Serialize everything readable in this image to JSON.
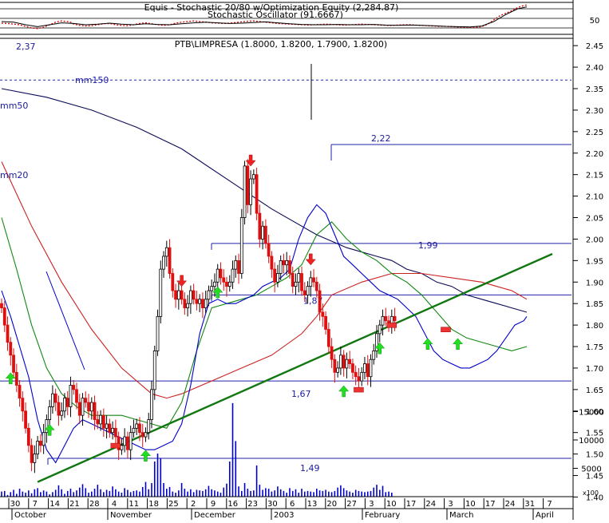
{
  "chart_data": [
    {
      "type": "line",
      "title": "Equis - Stochastic 20/80 w/Optimization Equity (2,284.87)",
      "subtitle": "Stochastic Oscillator (91.6667)",
      "y_ticks": [
        "50"
      ],
      "levels": [
        20,
        50,
        80
      ],
      "series": [
        {
          "color": "#cc0000",
          "style": "dotted",
          "x": [
            0,
            2,
            4,
            6,
            8,
            10,
            12,
            14,
            16,
            18,
            20,
            22,
            23,
            24,
            26,
            28,
            30,
            32,
            34,
            36,
            38,
            40,
            42,
            44,
            46,
            48,
            50,
            52,
            54,
            56,
            58,
            60,
            62,
            64,
            66,
            68,
            70,
            72,
            74,
            76,
            78,
            80,
            82,
            84,
            86,
            88,
            90,
            92,
            94,
            96,
            98,
            100,
            102,
            104,
            106,
            108,
            110,
            112,
            114,
            116,
            118,
            120,
            122,
            124,
            126,
            128,
            130,
            132,
            134,
            136,
            138,
            140,
            142,
            144,
            146,
            148,
            150,
            152,
            154,
            156,
            158,
            160,
            162,
            164,
            166,
            168,
            170,
            172,
            174,
            175
          ],
          "y": [
            35,
            34,
            32,
            30,
            25,
            20,
            18,
            22,
            30,
            38,
            42,
            40,
            38,
            32,
            28,
            26,
            27,
            30,
            33,
            34,
            30,
            28,
            27,
            30,
            34,
            36,
            33,
            30,
            28,
            30,
            35,
            38,
            40,
            42,
            40,
            38,
            36,
            35,
            34,
            35,
            37,
            39,
            41,
            42,
            40,
            38,
            36,
            34,
            33,
            32,
            31,
            30,
            29,
            30,
            31,
            32,
            31,
            30,
            29,
            30,
            31,
            32,
            31,
            30,
            29,
            28,
            28,
            29,
            30,
            30,
            29,
            28,
            27,
            26,
            25,
            25,
            24,
            23,
            23,
            22,
            22,
            24,
            32,
            45,
            58,
            66,
            74,
            84,
            90,
            92
          ]
        },
        {
          "color": "#000000",
          "style": "solid",
          "x": [
            0,
            4,
            8,
            12,
            16,
            20,
            24,
            28,
            32,
            36,
            40,
            44,
            48,
            52,
            56,
            60,
            64,
            68,
            72,
            76,
            80,
            84,
            88,
            92,
            96,
            100,
            104,
            108,
            112,
            116,
            120,
            124,
            128,
            132,
            136,
            140,
            144,
            148,
            152,
            156,
            160,
            164,
            168,
            172,
            175
          ],
          "y": [
            40,
            38,
            30,
            24,
            30,
            36,
            34,
            30,
            32,
            35,
            32,
            30,
            33,
            31,
            30,
            33,
            36,
            38,
            36,
            34,
            35,
            37,
            39,
            36,
            33,
            31,
            30,
            30,
            31,
            30,
            30,
            31,
            29,
            28,
            29,
            28,
            27,
            25,
            24,
            23,
            26,
            40,
            62,
            80,
            86
          ]
        }
      ]
    },
    {
      "type": "candlestick",
      "title": "PTB\\LIMPRESA (1.8000, 1.8200, 1.7900, 1.8200)",
      "y_ticks": [
        "2.45",
        "2.40",
        "2.35",
        "2.30",
        "2.25",
        "2.20",
        "2.15",
        "2.10",
        "2.05",
        "2.00",
        "1.95",
        "1.90",
        "1.85",
        "1.80",
        "1.75",
        "1.70",
        "1.65",
        "1.60",
        "1.55",
        "1.50",
        "1.45",
        "1.40"
      ],
      "ylim": [
        1.373,
        2.467
      ],
      "x_dates": [
        "30",
        "7",
        "14",
        "21",
        "28",
        "4",
        "11",
        "18",
        "25",
        "2",
        "9",
        "16",
        "23",
        "30",
        "6",
        "13",
        "20",
        "27",
        "3",
        "10",
        "17",
        "24",
        "3",
        "10",
        "17",
        "24",
        "31",
        "7"
      ],
      "x_months": [
        "October",
        "November",
        "December",
        "2003",
        "February",
        "March",
        "April"
      ],
      "support_levels": [
        {
          "label": "2,37",
          "value": 2.37
        },
        {
          "label": "2,22",
          "value": 2.22
        },
        {
          "label": "1,99",
          "value": 1.99
        },
        {
          "label": "1,87",
          "value": 1.87
        },
        {
          "label": "1,67",
          "value": 1.67
        },
        {
          "label": "1,49",
          "value": 1.49
        }
      ],
      "moving_averages": [
        {
          "name": "mm150",
          "color": "#0a0a55",
          "x": [
            0,
            15,
            30,
            45,
            60,
            75,
            90,
            105,
            115,
            125,
            130,
            135,
            140,
            145,
            150,
            155,
            160,
            165,
            170,
            175
          ],
          "y": [
            2.35,
            2.33,
            2.3,
            2.26,
            2.21,
            2.14,
            2.07,
            2.01,
            1.98,
            1.96,
            1.95,
            1.93,
            1.92,
            1.9,
            1.89,
            1.87,
            1.86,
            1.85,
            1.84,
            1.83
          ]
        },
        {
          "name": "mm50",
          "color": "#cc2222",
          "x": [
            0,
            10,
            20,
            30,
            40,
            50,
            55,
            60,
            70,
            80,
            90,
            100,
            105,
            110,
            120,
            130,
            140,
            150,
            160,
            165,
            170,
            175
          ],
          "y": [
            2.18,
            2.03,
            1.9,
            1.79,
            1.7,
            1.64,
            1.63,
            1.64,
            1.67,
            1.7,
            1.73,
            1.78,
            1.82,
            1.87,
            1.9,
            1.92,
            1.92,
            1.91,
            1.9,
            1.89,
            1.88,
            1.86
          ]
        },
        {
          "name": "mm20",
          "color": "#118811",
          "x": [
            0,
            5,
            10,
            15,
            20,
            25,
            30,
            35,
            40,
            45,
            50,
            55,
            60,
            65,
            70,
            75,
            80,
            85,
            90,
            95,
            100,
            105,
            110,
            115,
            120,
            125,
            130,
            135,
            140,
            145,
            150,
            155,
            160,
            165,
            170,
            175
          ],
          "y": [
            2.05,
            1.93,
            1.8,
            1.7,
            1.64,
            1.61,
            1.59,
            1.59,
            1.59,
            1.58,
            1.57,
            1.56,
            1.62,
            1.74,
            1.84,
            1.85,
            1.86,
            1.87,
            1.89,
            1.91,
            1.94,
            2.01,
            2.04,
            2.0,
            1.97,
            1.95,
            1.92,
            1.9,
            1.87,
            1.83,
            1.79,
            1.77,
            1.76,
            1.75,
            1.74,
            1.75
          ]
        },
        {
          "name": "",
          "color": "#0000cc",
          "x": [
            0,
            3,
            6,
            9,
            12,
            15,
            18,
            21,
            24,
            27,
            30,
            33,
            36,
            39,
            42,
            45,
            48,
            51,
            54,
            57,
            60,
            63,
            66,
            69,
            72,
            75,
            78,
            81,
            84,
            87,
            90,
            93,
            96,
            99,
            102,
            105,
            108,
            111,
            114,
            117,
            120,
            123,
            126,
            129,
            132,
            135,
            138,
            141,
            144,
            147,
            150,
            153,
            156,
            159,
            162,
            165,
            168,
            171,
            174,
            175
          ],
          "y": [
            1.88,
            1.82,
            1.75,
            1.68,
            1.58,
            1.51,
            1.48,
            1.52,
            1.56,
            1.58,
            1.57,
            1.56,
            1.55,
            1.54,
            1.53,
            1.52,
            1.51,
            1.51,
            1.52,
            1.53,
            1.57,
            1.66,
            1.78,
            1.85,
            1.86,
            1.85,
            1.85,
            1.86,
            1.87,
            1.89,
            1.9,
            1.91,
            1.93,
            2.0,
            2.05,
            2.08,
            2.06,
            2.01,
            1.96,
            1.94,
            1.92,
            1.9,
            1.88,
            1.87,
            1.86,
            1.84,
            1.82,
            1.78,
            1.74,
            1.72,
            1.71,
            1.7,
            1.7,
            1.71,
            1.72,
            1.74,
            1.77,
            1.8,
            1.81,
            1.82
          ]
        }
      ],
      "trendline": {
        "color": "#117711",
        "x": [
          12,
          172
        ],
        "y": [
          1.435,
          1.708
        ]
      },
      "candles_close": [
        1.84,
        1.8,
        1.76,
        1.73,
        1.69,
        1.66,
        1.63,
        1.6,
        1.56,
        1.52,
        1.48,
        1.5,
        1.53,
        1.52,
        1.55,
        1.58,
        1.61,
        1.64,
        1.62,
        1.59,
        1.6,
        1.63,
        1.61,
        1.66,
        1.65,
        1.62,
        1.59,
        1.63,
        1.62,
        1.6,
        1.62,
        1.58,
        1.57,
        1.59,
        1.56,
        1.57,
        1.55,
        1.56,
        1.54,
        1.51,
        1.52,
        1.54,
        1.51,
        1.55,
        1.56,
        1.57,
        1.55,
        1.54,
        1.55,
        1.58,
        1.65,
        1.74,
        1.82,
        1.93,
        1.96,
        1.98,
        1.92,
        1.88,
        1.86,
        1.88,
        1.86,
        1.84,
        1.85,
        1.88,
        1.86,
        1.85,
        1.86,
        1.84,
        1.86,
        1.88,
        1.89,
        1.9,
        1.93,
        1.91,
        1.9,
        1.89,
        1.9,
        1.93,
        1.95,
        1.92,
        2.05,
        2.17,
        2.08,
        2.14,
        2.15,
        2.06,
        2.0,
        2.03,
        1.99,
        1.96,
        1.93,
        1.9,
        1.92,
        1.95,
        1.94,
        1.95,
        1.92,
        1.89,
        1.9,
        1.92,
        1.88,
        1.87,
        1.89,
        1.91,
        1.9,
        1.88,
        1.83,
        1.82,
        1.79,
        1.75,
        1.72,
        1.69,
        1.7,
        1.73,
        1.7,
        1.72,
        1.71,
        1.69,
        1.68,
        1.67,
        1.69,
        1.71,
        1.68,
        1.72,
        1.74,
        1.78,
        1.8,
        1.82,
        1.81,
        1.8,
        1.82,
        1.81
      ],
      "buy_signals_x": [
        3,
        16,
        48,
        72,
        114,
        126,
        142,
        152
      ],
      "sell_signals_x": [
        60,
        83,
        103
      ],
      "event_marks_x": [
        38,
        119,
        130,
        148
      ]
    },
    {
      "type": "bar",
      "y_ticks": [
        "15000",
        "10000",
        "5000"
      ],
      "ylim": [
        0,
        20000
      ],
      "unit_label": "x100",
      "values": [
        900,
        1000,
        300,
        800,
        1200,
        500,
        1400,
        900,
        700,
        1100,
        600,
        1300,
        1500,
        800,
        1100,
        900,
        400,
        800,
        1200,
        2000,
        1300,
        500,
        1000,
        1400,
        800,
        1100,
        1600,
        2200,
        1500,
        700,
        900,
        1400,
        2100,
        1300,
        800,
        1200,
        1000,
        1800,
        1300,
        900,
        700,
        1500,
        1200,
        800,
        1000,
        1100,
        900,
        1700,
        2600,
        1300,
        2400,
        6200,
        7600,
        6800,
        2400,
        1400,
        1700,
        900,
        700,
        1100,
        2400,
        1400,
        900,
        1300,
        800,
        1200,
        1100,
        1000,
        1300,
        1900,
        1300,
        1100,
        900,
        700,
        1600,
        2300,
        6200,
        16500,
        9800,
        1800,
        1000,
        2400,
        1400,
        1000,
        1100,
        5500,
        2100,
        1200,
        1500,
        1400,
        900,
        1100,
        1800,
        1300,
        1000,
        700,
        1500,
        1000,
        1300,
        700,
        1400,
        900,
        1000,
        900,
        800,
        1400,
        1100,
        1000,
        1200,
        900,
        800,
        1000,
        1600,
        2000,
        1500,
        1100,
        900,
        700,
        1200,
        1000,
        900,
        800,
        900,
        1000,
        1600,
        2100,
        1200,
        1900,
        800,
        900,
        700
      ]
    }
  ]
}
